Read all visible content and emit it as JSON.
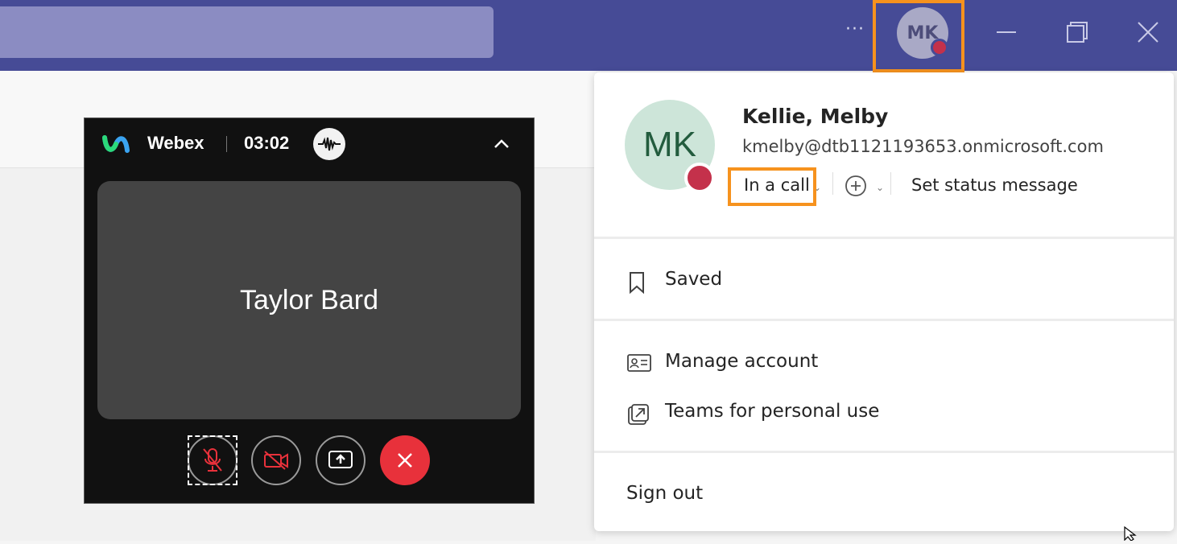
{
  "titlebar": {
    "more_label": "···",
    "account_initials": "MK",
    "presence_color": "#c4314b",
    "accent": "#464b96",
    "icons": [
      "minimize-icon",
      "restore-icon",
      "close-icon"
    ]
  },
  "webex": {
    "app_name": "Webex",
    "timer": "03:02",
    "participant": "Taylor Bard",
    "end_color": "#e8313b",
    "icons": [
      "webex-logo-icon",
      "audio-wave-icon",
      "chevron-up-icon",
      "mic-off-icon",
      "video-off-icon",
      "share-screen-icon",
      "end-call-icon"
    ]
  },
  "profile": {
    "initials": "MK",
    "name": "Kellie, Melby",
    "email": "kmelby@dtb1121193653.onmicrosoft.com",
    "status": "In a call",
    "set_status": "Set status message",
    "avatar_bg": "#cde5d9",
    "highlight_color": "#f6921e"
  },
  "menu": {
    "saved": "Saved",
    "manage_account": "Manage account",
    "personal_use": "Teams for personal use",
    "sign_out": "Sign out"
  }
}
